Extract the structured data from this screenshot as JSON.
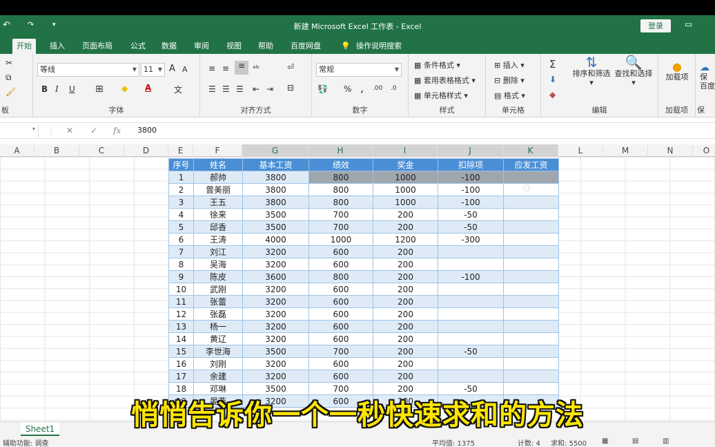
{
  "window": {
    "title": "新建 Microsoft Excel 工作表 - Excel",
    "login": "登录"
  },
  "quick_access": {
    "undo": "↶",
    "redo": "↷",
    "customize": "▾"
  },
  "tabs": [
    "开始",
    "插入",
    "页面布局",
    "公式",
    "数据",
    "审阅",
    "视图",
    "帮助",
    "百度网盘",
    "操作说明搜索"
  ],
  "ribbon": {
    "clipboard_label": "板",
    "font": {
      "name": "等线",
      "size": "11",
      "grow": "A",
      "shrink": "A",
      "bold": "B",
      "italic": "I",
      "underline": "U",
      "label": "字体"
    },
    "alignment_label": "对齐方式",
    "number": {
      "format": "常规",
      "percent": "%",
      "comma": ",",
      "label": "数字"
    },
    "styles": {
      "conditional": "条件格式",
      "table": "套用表格格式",
      "cell": "单元格样式",
      "label": "样式"
    },
    "cells": {
      "insert": "插入",
      "delete": "删除",
      "format": "格式",
      "label": "单元格"
    },
    "editing": {
      "sum": "Σ",
      "sort": "排序和筛选",
      "find": "查找和选择",
      "label": "编辑"
    },
    "addins": {
      "button": "加载项",
      "label": "加载项"
    },
    "extra": {
      "label1": "保",
      "label2": "百度",
      "label3": "保"
    }
  },
  "formula_bar": {
    "value": "3800",
    "fx": "fx"
  },
  "columns": [
    "A",
    "B",
    "C",
    "D",
    "E",
    "F",
    "G",
    "H",
    "I",
    "J",
    "K",
    "L",
    "M",
    "N",
    "O"
  ],
  "table": {
    "headers": [
      "序号",
      "姓名",
      "基本工资",
      "绩效",
      "奖金",
      "扣除项",
      "应发工资"
    ],
    "rows": [
      [
        "1",
        "郝帅",
        "3800",
        "800",
        "1000",
        "-100",
        ""
      ],
      [
        "2",
        "曾美丽",
        "3800",
        "800",
        "1000",
        "-100",
        ""
      ],
      [
        "3",
        "王五",
        "3800",
        "800",
        "1000",
        "-100",
        ""
      ],
      [
        "4",
        "徐来",
        "3500",
        "700",
        "200",
        "-50",
        ""
      ],
      [
        "5",
        "邱香",
        "3500",
        "700",
        "200",
        "-50",
        ""
      ],
      [
        "6",
        "王涛",
        "4000",
        "1000",
        "1200",
        "-300",
        ""
      ],
      [
        "7",
        "刘江",
        "3200",
        "600",
        "200",
        "",
        ""
      ],
      [
        "8",
        "吴海",
        "3200",
        "600",
        "200",
        "",
        ""
      ],
      [
        "9",
        "陈皮",
        "3600",
        "800",
        "200",
        "-100",
        ""
      ],
      [
        "10",
        "武刚",
        "3200",
        "600",
        "200",
        "",
        ""
      ],
      [
        "11",
        "张蕾",
        "3200",
        "600",
        "200",
        "",
        ""
      ],
      [
        "12",
        "张磊",
        "3200",
        "600",
        "200",
        "",
        ""
      ],
      [
        "13",
        "杨一",
        "3200",
        "600",
        "200",
        "",
        ""
      ],
      [
        "14",
        "黄辽",
        "3200",
        "600",
        "200",
        "",
        ""
      ],
      [
        "15",
        "李世海",
        "3500",
        "700",
        "200",
        "-50",
        ""
      ],
      [
        "16",
        "刘刚",
        "3200",
        "600",
        "200",
        "",
        ""
      ],
      [
        "17",
        "余建",
        "3200",
        "600",
        "200",
        "",
        ""
      ],
      [
        "18",
        "邓琳",
        "3500",
        "700",
        "200",
        "-50",
        ""
      ],
      [
        "19",
        "晏燕",
        "3200",
        "600",
        "200",
        "",
        ""
      ]
    ]
  },
  "sheet": {
    "tab": "Sheet1"
  },
  "status": {
    "left": "辅助功能: 调查",
    "average": "平均值: 1375",
    "count": "计数: 4",
    "sum": "求和: 5500"
  },
  "caption": "悄悄告诉你一个一秒快速求和的方法"
}
